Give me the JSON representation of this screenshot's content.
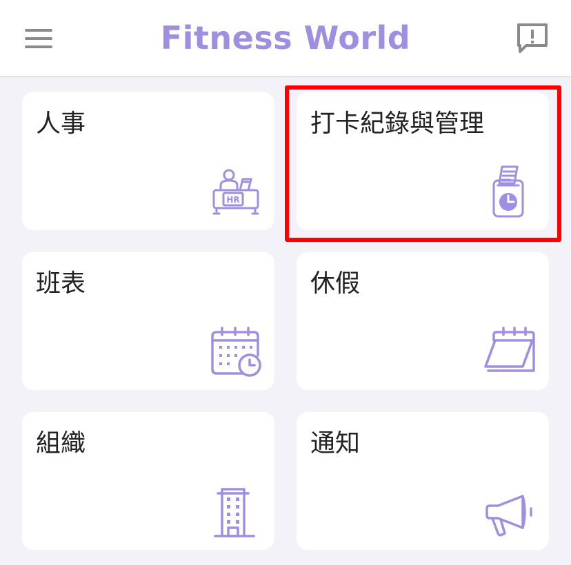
{
  "header": {
    "title": "Fitness World",
    "menu_icon": "menu-icon",
    "feedback_icon": "feedback-icon"
  },
  "colors": {
    "accent": "#a08fe0",
    "icon_gray": "#8a8a8a",
    "background": "#f3f2f8",
    "highlight": "#ff0000"
  },
  "cards": [
    {
      "label": "人事",
      "icon": "hr-desk-icon"
    },
    {
      "label": "打卡紀錄與管理",
      "icon": "punch-clock-icon",
      "highlighted": true
    },
    {
      "label": "班表",
      "icon": "calendar-clock-icon"
    },
    {
      "label": "休假",
      "icon": "calendar-icon"
    },
    {
      "label": "組織",
      "icon": "building-icon"
    },
    {
      "label": "通知",
      "icon": "megaphone-icon"
    }
  ]
}
